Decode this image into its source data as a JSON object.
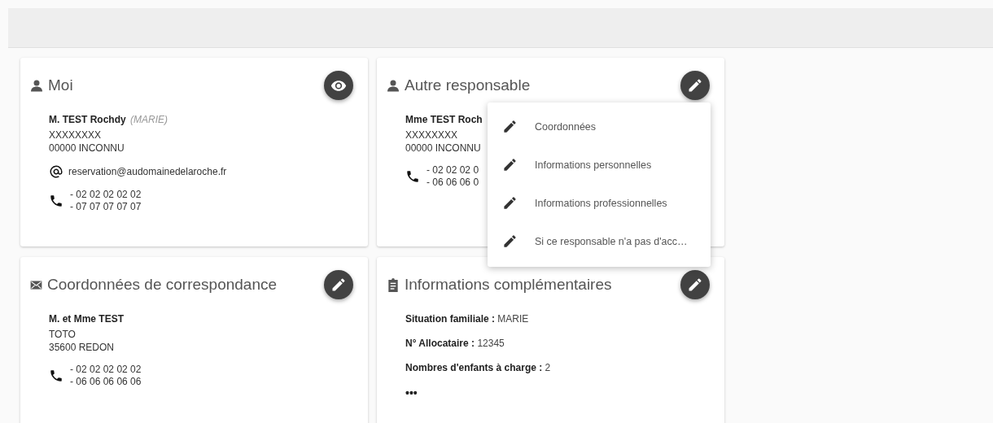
{
  "cards": [
    {
      "title": "Moi",
      "kind": "contact",
      "name": "M. TEST Rochdy",
      "qualifier": "(MARIE)",
      "address": [
        "XXXXXXXX",
        "00000 INCONNU"
      ],
      "email": "reservation@audomainedelaroche.fr",
      "phones": [
        "- 02 02 02 02 02",
        "- 07 07 07 07 07"
      ]
    },
    {
      "title": "Autre responsable",
      "kind": "contact",
      "name": "Mme TEST Roch",
      "address": [
        "XXXXXXXX",
        "00000 INCONNU"
      ],
      "phones": [
        "- 02 02 02 0",
        "- 06 06 06 0"
      ]
    },
    {
      "title": "Coordonnées de correspondance",
      "kind": "contact",
      "name": "M. et Mme TEST",
      "address": [
        "TOTO",
        "35600 REDON"
      ],
      "phones": [
        "- 02 02 02 02 02",
        "- 06 06 06 06 06"
      ]
    },
    {
      "title": "Informations complémentaires",
      "kind": "info",
      "fields": [
        {
          "label": "Situation familiale :",
          "value": "MARIE"
        },
        {
          "label": "N° Allocataire :",
          "value": "12345"
        },
        {
          "label": "Nombres d'enfants à charge :",
          "value": "2"
        }
      ],
      "more": "•••"
    }
  ],
  "menu": {
    "items": [
      {
        "label": "Coordonnées"
      },
      {
        "label": "Informations personnelles"
      },
      {
        "label": "Informations professionnelles"
      },
      {
        "label": "Si ce responsable n'a pas d'acc…"
      }
    ]
  }
}
